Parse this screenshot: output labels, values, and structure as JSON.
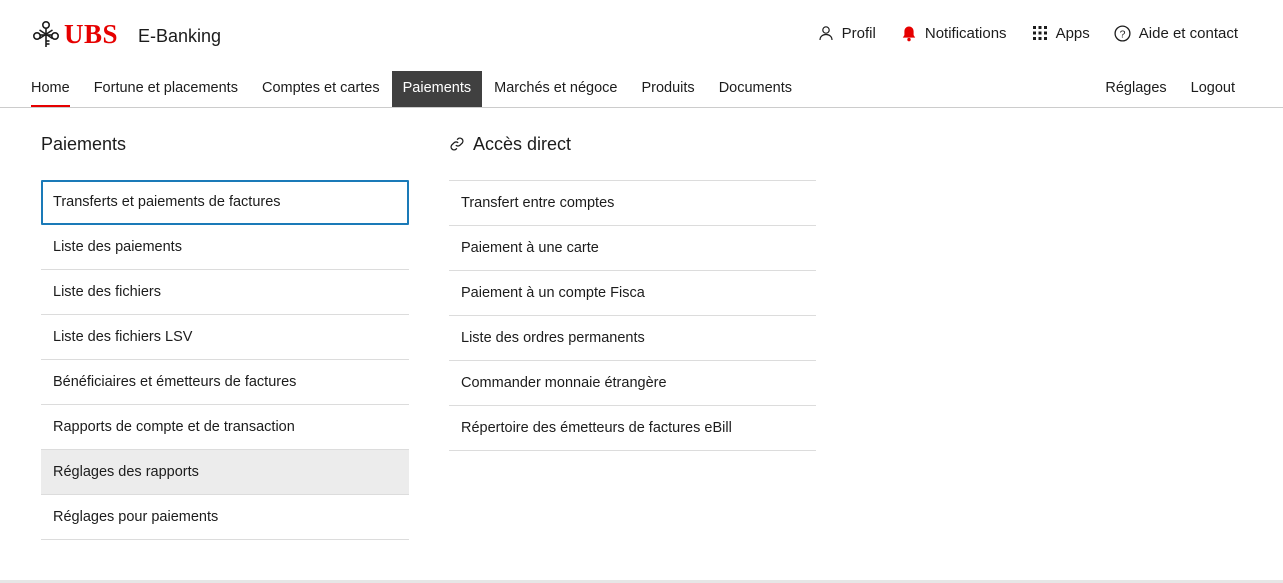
{
  "brand": {
    "name": "UBS",
    "app_title": "E-Banking",
    "accent_color": "#e60000"
  },
  "utilities": [
    {
      "label": "Profil",
      "icon": "person-icon"
    },
    {
      "label": "Notifications",
      "icon": "bell-icon"
    },
    {
      "label": "Apps",
      "icon": "grid-icon"
    },
    {
      "label": "Aide et contact",
      "icon": "help-icon"
    }
  ],
  "nav": {
    "items": [
      "Home",
      "Fortune et placements",
      "Comptes et cartes",
      "Paiements",
      "Marchés et négoce",
      "Produits",
      "Documents"
    ],
    "active": "Paiements",
    "right": [
      "Réglages",
      "Logout"
    ]
  },
  "payments": {
    "title": "Paiements",
    "items": [
      "Transferts et paiements de factures",
      "Liste des paiements",
      "Liste des fichiers",
      "Liste des fichiers LSV",
      "Bénéficiaires et émetteurs de factures",
      "Rapports de compte et de transaction",
      "Réglages des rapports",
      "Réglages pour paiements"
    ]
  },
  "direct_access": {
    "title": "Accès direct",
    "icon": "link-icon",
    "items": [
      "Transfert entre comptes",
      "Paiement à une carte",
      "Paiement à un compte Fisca",
      "Liste des ordres permanents",
      "Commander monnaie étrangère",
      "Répertoire des émetteurs de factures eBill"
    ]
  }
}
